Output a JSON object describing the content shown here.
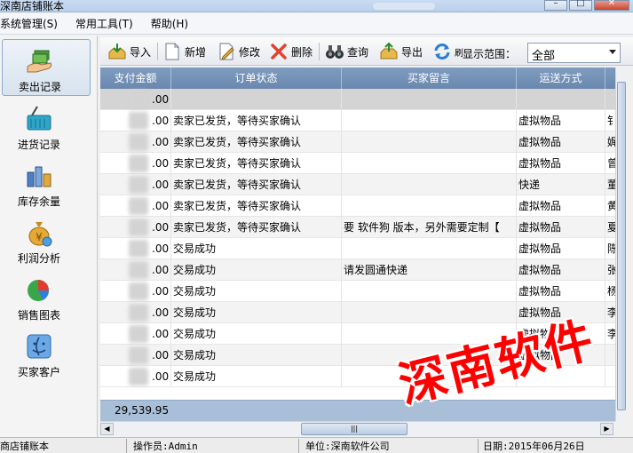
{
  "window": {
    "title": "深南店铺账本"
  },
  "menu": [
    "系统管理(S)",
    "常用工具(T)",
    "帮助(H)"
  ],
  "nav": [
    {
      "label": "卖出记录",
      "icon": "money-hand-icon",
      "active": true
    },
    {
      "label": "进货记录",
      "icon": "basket-icon",
      "active": false
    },
    {
      "label": "库存余量",
      "icon": "warehouse-icon",
      "active": false
    },
    {
      "label": "利润分析",
      "icon": "money-bag-icon",
      "active": false
    },
    {
      "label": "销售图表",
      "icon": "pie-chart-icon",
      "active": false
    },
    {
      "label": "买家客户",
      "icon": "customer-icon",
      "active": false
    }
  ],
  "toolbar": {
    "import": "导入",
    "new": "新增",
    "edit": "修改",
    "delete": "删除",
    "query": "查询",
    "export": "导出",
    "refresh": "刷",
    "range_label": "显示范围：",
    "range_value": "全部"
  },
  "grid": {
    "columns": [
      "支付金额",
      "订单状态",
      "买家留言",
      "运送方式",
      ""
    ],
    "rows": [
      {
        "amount": ".00",
        "status": "",
        "note": "",
        "ship": "",
        "extra": ""
      },
      {
        "amount": ".00",
        "status": "卖家已发货，等待买家确认",
        "note": "",
        "ship": "虚拟物品",
        "extra": "钅"
      },
      {
        "amount": ".00",
        "status": "卖家已发货，等待买家确认",
        "note": "",
        "ship": "虚拟物品",
        "extra": "娓"
      },
      {
        "amount": ".00",
        "status": "卖家已发货，等待买家确认",
        "note": "",
        "ship": "虚拟物品",
        "extra": "曾"
      },
      {
        "amount": ".00",
        "status": "卖家已发货，等待买家确认",
        "note": "",
        "ship": "快递",
        "extra": "董"
      },
      {
        "amount": ".00",
        "status": "卖家已发货，等待买家确认",
        "note": "",
        "ship": "虚拟物品",
        "extra": "黄"
      },
      {
        "amount": ".00",
        "status": "卖家已发货，等待买家确认",
        "note": "要 软件狗 版本，另外需要定制【",
        "ship": "虚拟物品",
        "extra": "夏"
      },
      {
        "amount": ".00",
        "status": "交易成功",
        "note": "",
        "ship": "虚拟物品",
        "extra": "陈"
      },
      {
        "amount": ".00",
        "status": "交易成功",
        "note": "请发圆通快递",
        "ship": "虚拟物品",
        "extra": "张"
      },
      {
        "amount": ".00",
        "status": "交易成功",
        "note": "",
        "ship": "虚拟物品",
        "extra": "杨"
      },
      {
        "amount": ".00",
        "status": "交易成功",
        "note": "",
        "ship": "虚拟物品",
        "extra": "李"
      },
      {
        "amount": ".00",
        "status": "交易成功",
        "note": "",
        "ship": "虚拟物品",
        "extra": "李"
      },
      {
        "amount": ".00",
        "status": "交易成功",
        "note": "",
        "ship": "虚拟物品",
        "extra": ""
      },
      {
        "amount": ".00",
        "status": "交易成功",
        "note": "",
        "ship": "",
        "extra": ""
      }
    ],
    "total": "29,539.95"
  },
  "status": {
    "app": "商店铺账本",
    "operator": "操作员:Admin",
    "unit": "单位:深南软件公司",
    "date": "日期:2015年06月26日"
  },
  "watermark": "深南软件",
  "colors": {
    "header": "#7f9cc0",
    "watermark": "#ff0000",
    "nav_active": "#d7e3ef"
  }
}
